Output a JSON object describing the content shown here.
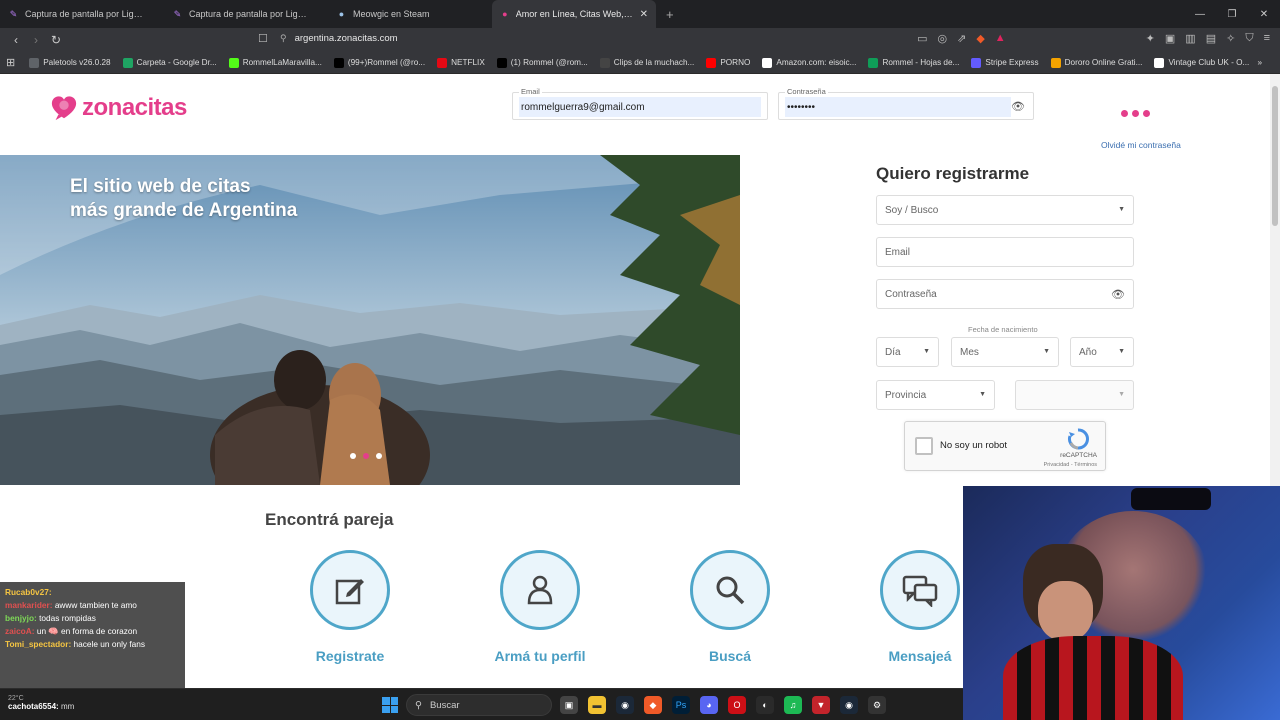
{
  "browser": {
    "tabs": [
      {
        "label": "Captura de pantalla por Lightshot",
        "active": false
      },
      {
        "label": "Captura de pantalla por Lightshot",
        "active": false
      },
      {
        "label": "Meowgic en Steam",
        "active": false
      },
      {
        "label": "Amor en Línea, Citas Web, Solos",
        "active": true
      }
    ],
    "url": "argentina.zonacitas.com",
    "bookmarks": [
      {
        "label": "Paletools v26.0.28",
        "icon": "globe-icon",
        "color": "#5f6368"
      },
      {
        "label": "Carpeta - Google Dr...",
        "icon": "drive-icon",
        "color": "#1fa463"
      },
      {
        "label": "RommelLaMaravilla...",
        "icon": "kick-icon",
        "color": "#53fc18"
      },
      {
        "label": "(99+)Rommel (@ro...",
        "icon": "tiktok-icon",
        "color": "#000000"
      },
      {
        "label": "NETFLIX",
        "icon": "netflix-icon",
        "color": "#e50914"
      },
      {
        "label": "(1) Rommel (@rom...",
        "icon": "x-icon",
        "color": "#000000"
      },
      {
        "label": "Clips de la muchach...",
        "icon": "notion-icon",
        "color": "#444444"
      },
      {
        "label": "PORNO",
        "icon": "youtube-icon",
        "color": "#ff0000"
      },
      {
        "label": "Amazon.com: eisoic...",
        "icon": "amazon-icon",
        "color": "#ffffff"
      },
      {
        "label": "Rommel - Hojas de...",
        "icon": "sheets-icon",
        "color": "#0f9d58"
      },
      {
        "label": "Stripe Express",
        "icon": "stripe-icon",
        "color": "#635bff"
      },
      {
        "label": "Dororo Online Grati...",
        "icon": "ac-icon",
        "color": "#f4a300"
      },
      {
        "label": "Vintage Club UK - O...",
        "icon": "bag-icon",
        "color": "#ffffff"
      }
    ]
  },
  "site": {
    "logo_text": "zonacitas",
    "brand_color": "#e43e8b",
    "accent_color": "#4fa6c9",
    "login": {
      "email_label": "Email",
      "email_value": "rommelguerra9@gmail.com",
      "password_label": "Contraseña",
      "password_value": "••••••••",
      "forgot": "Olvidé mi contraseña"
    },
    "hero": {
      "title_line1": "El sitio web de citas",
      "title_line2": "más grande de Argentina"
    },
    "register": {
      "title": "Quiero registrarme",
      "soy_busco": "Soy / Busco",
      "email_placeholder": "Email",
      "password_placeholder": "Contraseña",
      "dob_label": "Fecha de nacimiento",
      "day": "Día",
      "month": "Mes",
      "year": "Año",
      "province": "Provincia",
      "captcha_text": "No soy un robot",
      "captcha_brand": "reCAPTCHA",
      "captcha_terms": "Privacidad - Términos"
    },
    "features": {
      "title": "Encontrá pareja",
      "items": [
        {
          "label": "Registrate",
          "icon": "edit-icon"
        },
        {
          "label": "Armá tu perfil",
          "icon": "profile-icon"
        },
        {
          "label": "Buscá",
          "icon": "search-icon"
        },
        {
          "label": "Mensajeá",
          "icon": "chat-icon"
        }
      ]
    }
  },
  "stream_chat": [
    {
      "user": "Rucab0v27:",
      "message": "",
      "color": "#f5c542"
    },
    {
      "user": "mankarider:",
      "message": "awww tambien te amo",
      "color": "#e05050"
    },
    {
      "user": "benjyjo:",
      "message": "todas rompidas",
      "color": "#7ed957"
    },
    {
      "user": "zaicoA:",
      "message": "un 🧠 en forma de corazon",
      "color": "#e05050"
    },
    {
      "user": "Tomi_spectador:",
      "message": "hacele un only fans",
      "color": "#f5c542"
    }
  ],
  "taskbar": {
    "chat_user": "cachota6554:",
    "chat_msg": "mm",
    "weather": "22°C",
    "search_label": "Buscar"
  }
}
